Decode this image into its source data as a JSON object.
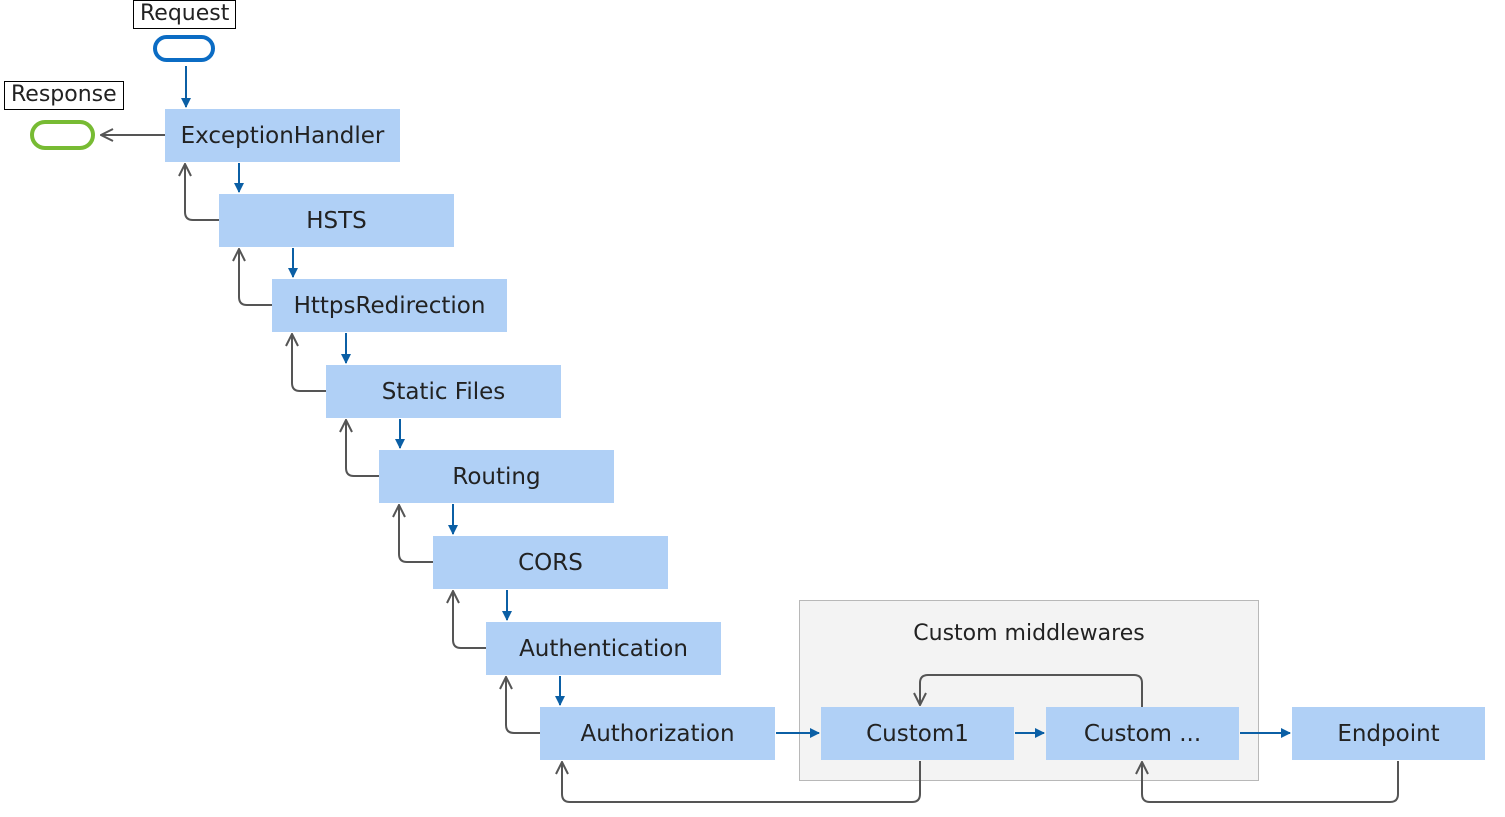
{
  "diagram": {
    "request_label": "Request",
    "response_label": "Response",
    "pipeline": [
      {
        "id": "exception-handler",
        "label": "ExceptionHandler"
      },
      {
        "id": "hsts",
        "label": "HSTS"
      },
      {
        "id": "https-redirection",
        "label": "HttpsRedirection"
      },
      {
        "id": "static-files",
        "label": "Static Files"
      },
      {
        "id": "routing",
        "label": "Routing"
      },
      {
        "id": "cors",
        "label": "CORS"
      },
      {
        "id": "authentication",
        "label": "Authentication"
      },
      {
        "id": "authorization",
        "label": "Authorization"
      }
    ],
    "custom_group": {
      "title": "Custom middlewares",
      "items": [
        {
          "id": "custom1",
          "label": "Custom1"
        },
        {
          "id": "custom-more",
          "label": "Custom ..."
        }
      ]
    },
    "endpoint": {
      "label": "Endpoint"
    },
    "colors": {
      "node_fill": "#b0d0f6",
      "request_arrow": "#0b5fa5",
      "response_arrow": "#555555",
      "request_terminal": "#0b6cc4",
      "response_terminal": "#77bb33",
      "group_fill": "#f3f3f3"
    }
  }
}
